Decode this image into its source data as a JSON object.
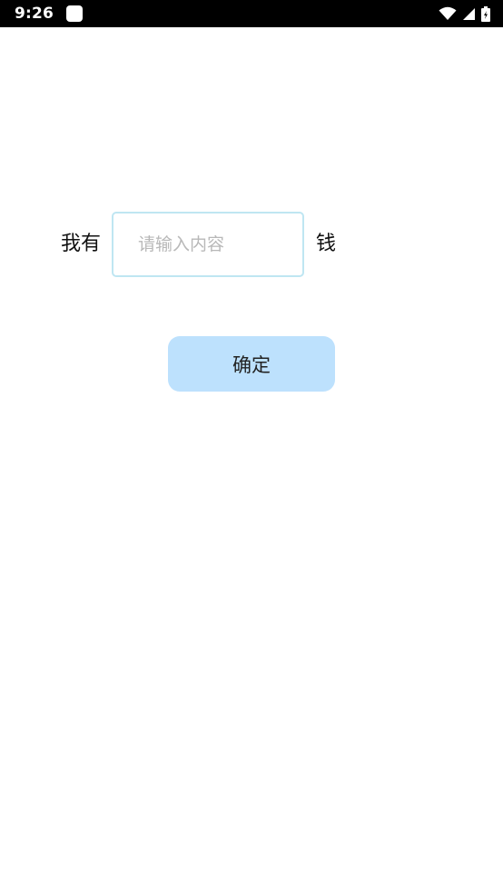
{
  "status_bar": {
    "time": "9:26",
    "icons": [
      "app-notification-icon",
      "wifi-icon",
      "signal-icon",
      "battery-icon"
    ]
  },
  "form": {
    "label_left": "我有",
    "input_placeholder": "请输入内容",
    "input_value": "",
    "label_right": "钱",
    "confirm_label": "确定"
  },
  "colors": {
    "status_bar_bg": "#000000",
    "input_border": "#bfe6f2",
    "button_bg": "#bde1fd",
    "placeholder": "#b8b8b8"
  }
}
